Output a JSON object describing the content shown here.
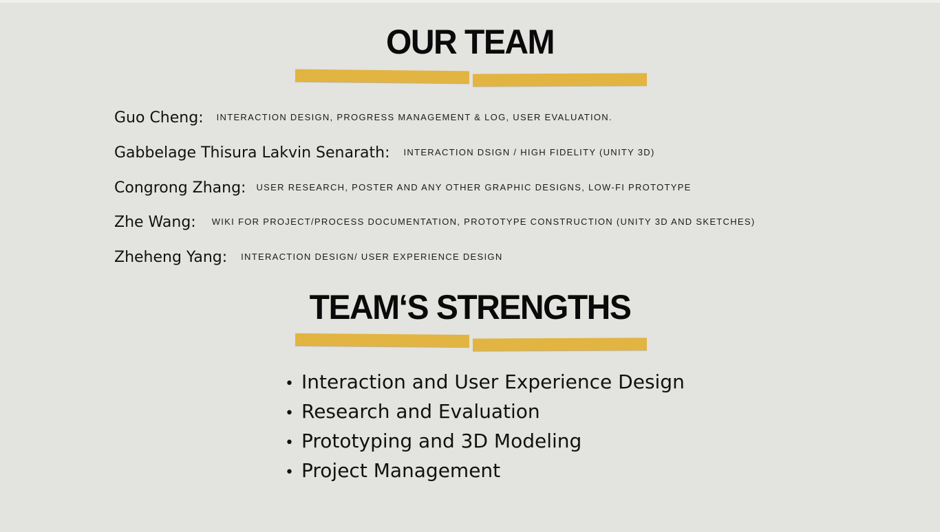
{
  "headings": {
    "team": "OUR TEAM",
    "strengths": "TEAM‘S STRENGTHS"
  },
  "members": [
    {
      "name": "Guo Cheng:",
      "role": "INTERACTION DESIGN, PROGRESS MANAGEMENT & LOG, USER EVALUATION."
    },
    {
      "name": "Gabbelage Thisura Lakvin Senarath:",
      "role": "INTERACTION DSIGN / HIGH FIDELITY (UNITY 3D)"
    },
    {
      "name": "Congrong Zhang:",
      "role": "USER RESEARCH, POSTER AND ANY OTHER GRAPHIC DESIGNS, LOW-FI PROTOTYPE"
    },
    {
      "name": "Zhe Wang:",
      "role": "WIKI FOR PROJECT/PROCESS DOCUMENTATION, PROTOTYPE CONSTRUCTION (UNITY 3D AND SKETCHES)"
    },
    {
      "name": "Zheheng Yang:",
      "role": "INTERACTION DESIGN/ USER EXPERIENCE DESIGN"
    }
  ],
  "strengths": [
    "Interaction and User Experience Design",
    "Research and Evaluation",
    "Prototyping and 3D Modeling",
    "Project Management"
  ],
  "colors": {
    "background": "#e3e3df",
    "tape": "#e2b441",
    "text": "#0a0a0a"
  }
}
